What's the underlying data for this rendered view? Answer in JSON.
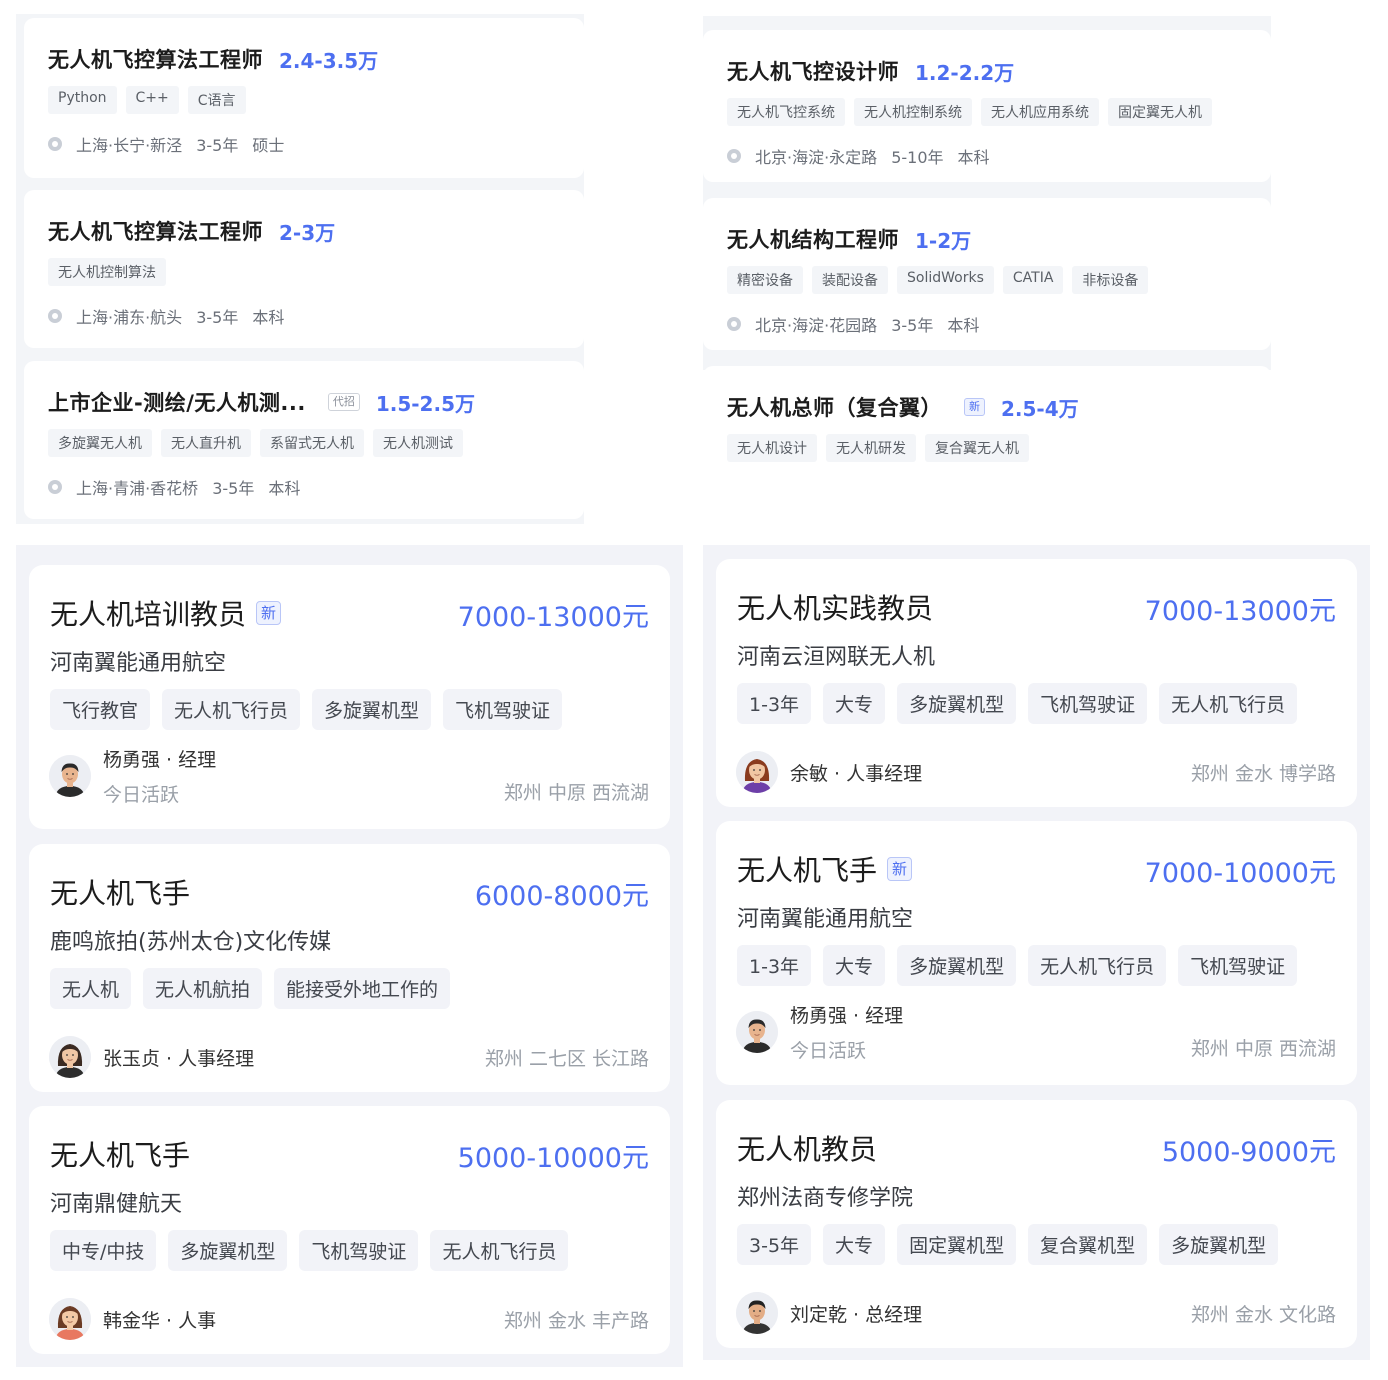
{
  "top_left": [
    {
      "title": "无人机飞控算法工程师",
      "badge": "",
      "salary": "2.4-3.5万",
      "tags": [
        "Python",
        "C++",
        "C语言"
      ],
      "location": "上海·长宁·新泾",
      "experience": "3-5年",
      "education": "硕士"
    },
    {
      "title": "无人机飞控算法工程师",
      "badge": "",
      "salary": "2-3万",
      "tags": [
        "无人机控制算法"
      ],
      "location": "上海·浦东·航头",
      "experience": "3-5年",
      "education": "本科"
    },
    {
      "title": "上市企业-测绘/无人机测...",
      "badge": "代招",
      "salary": "1.5-2.5万",
      "tags": [
        "多旋翼无人机",
        "无人直升机",
        "系留式无人机",
        "无人机测试"
      ],
      "location": "上海·青浦·香花桥",
      "experience": "3-5年",
      "education": "本科"
    }
  ],
  "top_right": [
    {
      "title": "无人机飞控设计师",
      "badge": "",
      "salary": "1.2-2.2万",
      "tags": [
        "无人机飞控系统",
        "无人机控制系统",
        "无人机应用系统",
        "固定翼无人机"
      ],
      "location": "北京·海淀·永定路",
      "experience": "5-10年",
      "education": "本科"
    },
    {
      "title": "无人机结构工程师",
      "badge": "",
      "salary": "1-2万",
      "tags": [
        "精密设备",
        "装配设备",
        "SolidWorks",
        "CATIA",
        "非标设备"
      ],
      "location": "北京·海淀·花园路",
      "experience": "3-5年",
      "education": "本科"
    },
    {
      "title": "无人机总师（复合翼）",
      "badge": "新",
      "salary": "2.5-4万",
      "tags": [
        "无人机设计",
        "无人机研发",
        "复合翼无人机"
      ],
      "location": "",
      "experience": "",
      "education": ""
    }
  ],
  "bottom_left": [
    {
      "title": "无人机培训教员",
      "new": "新",
      "salary": "7000-13000元",
      "company": "河南翼能通用航空",
      "tags": [
        "飞行教官",
        "无人机飞行员",
        "多旋翼机型",
        "飞机驾驶证"
      ],
      "contact": "杨勇强 · 经理",
      "active": "今日活跃",
      "location": "郑州 中原 西流湖"
    },
    {
      "title": "无人机飞手",
      "new": "",
      "salary": "6000-8000元",
      "company": "鹿鸣旅拍(苏州太仓)文化传媒",
      "tags": [
        "无人机",
        "无人机航拍",
        "能接受外地工作的"
      ],
      "contact": "张玉贞 · 人事经理",
      "active": "",
      "location": "郑州 二七区 长江路"
    },
    {
      "title": "无人机飞手",
      "new": "",
      "salary": "5000-10000元",
      "company": "河南鼎健航天",
      "tags": [
        "中专/中技",
        "多旋翼机型",
        "飞机驾驶证",
        "无人机飞行员"
      ],
      "contact": "韩金华 · 人事",
      "active": "",
      "location": "郑州 金水 丰产路"
    }
  ],
  "bottom_right": [
    {
      "title": "无人机实践教员",
      "new": "",
      "salary": "7000-13000元",
      "company": "河南云洹网联无人机",
      "tags": [
        "1-3年",
        "大专",
        "多旋翼机型",
        "飞机驾驶证",
        "无人机飞行员"
      ],
      "contact": "余敏 · 人事经理",
      "active": "",
      "location": "郑州 金水 博学路"
    },
    {
      "title": "无人机飞手",
      "new": "新",
      "salary": "7000-10000元",
      "company": "河南翼能通用航空",
      "tags": [
        "1-3年",
        "大专",
        "多旋翼机型",
        "无人机飞行员",
        "飞机驾驶证"
      ],
      "contact": "杨勇强 · 经理",
      "active": "今日活跃",
      "location": "郑州 中原 西流湖"
    },
    {
      "title": "无人机教员",
      "new": "",
      "salary": "5000-9000元",
      "company": "郑州法商专修学院",
      "tags": [
        "3-5年",
        "大专",
        "固定翼机型",
        "复合翼机型",
        "多旋翼机型"
      ],
      "contact": "刘定乾 · 总经理",
      "active": "",
      "location": "郑州 金水 文化路"
    }
  ],
  "avatars": [
    {
      "name": "male-avatar-icon",
      "skin": "#e8b48e",
      "hair": "#2a2a2a",
      "shirt": "#2b2b2b"
    },
    {
      "name": "female-avatar-icon",
      "skin": "#f0c6a4",
      "hair": "#3a2a22",
      "shirt": "#2d2d2d"
    },
    {
      "name": "female-avatar-icon",
      "skin": "#f3c9a6",
      "hair": "#6b3b24",
      "shirt": "#e87860"
    },
    {
      "name": "female-avatar-icon",
      "skin": "#f1c6a3",
      "hair": "#8a3b1e",
      "shirt": "#6d3fa8"
    },
    {
      "name": "male-avatar-icon",
      "skin": "#e8b48e",
      "hair": "#2a2a2a",
      "shirt": "#2b2b2b"
    },
    {
      "name": "male-avatar-icon",
      "skin": "#e3ad86",
      "hair": "#222222",
      "shirt": "#333333"
    }
  ],
  "colors": {
    "accent": "#4d6ff0",
    "panel_bg": "#f2f3f8",
    "tag_bg": "#f3f5f8"
  }
}
